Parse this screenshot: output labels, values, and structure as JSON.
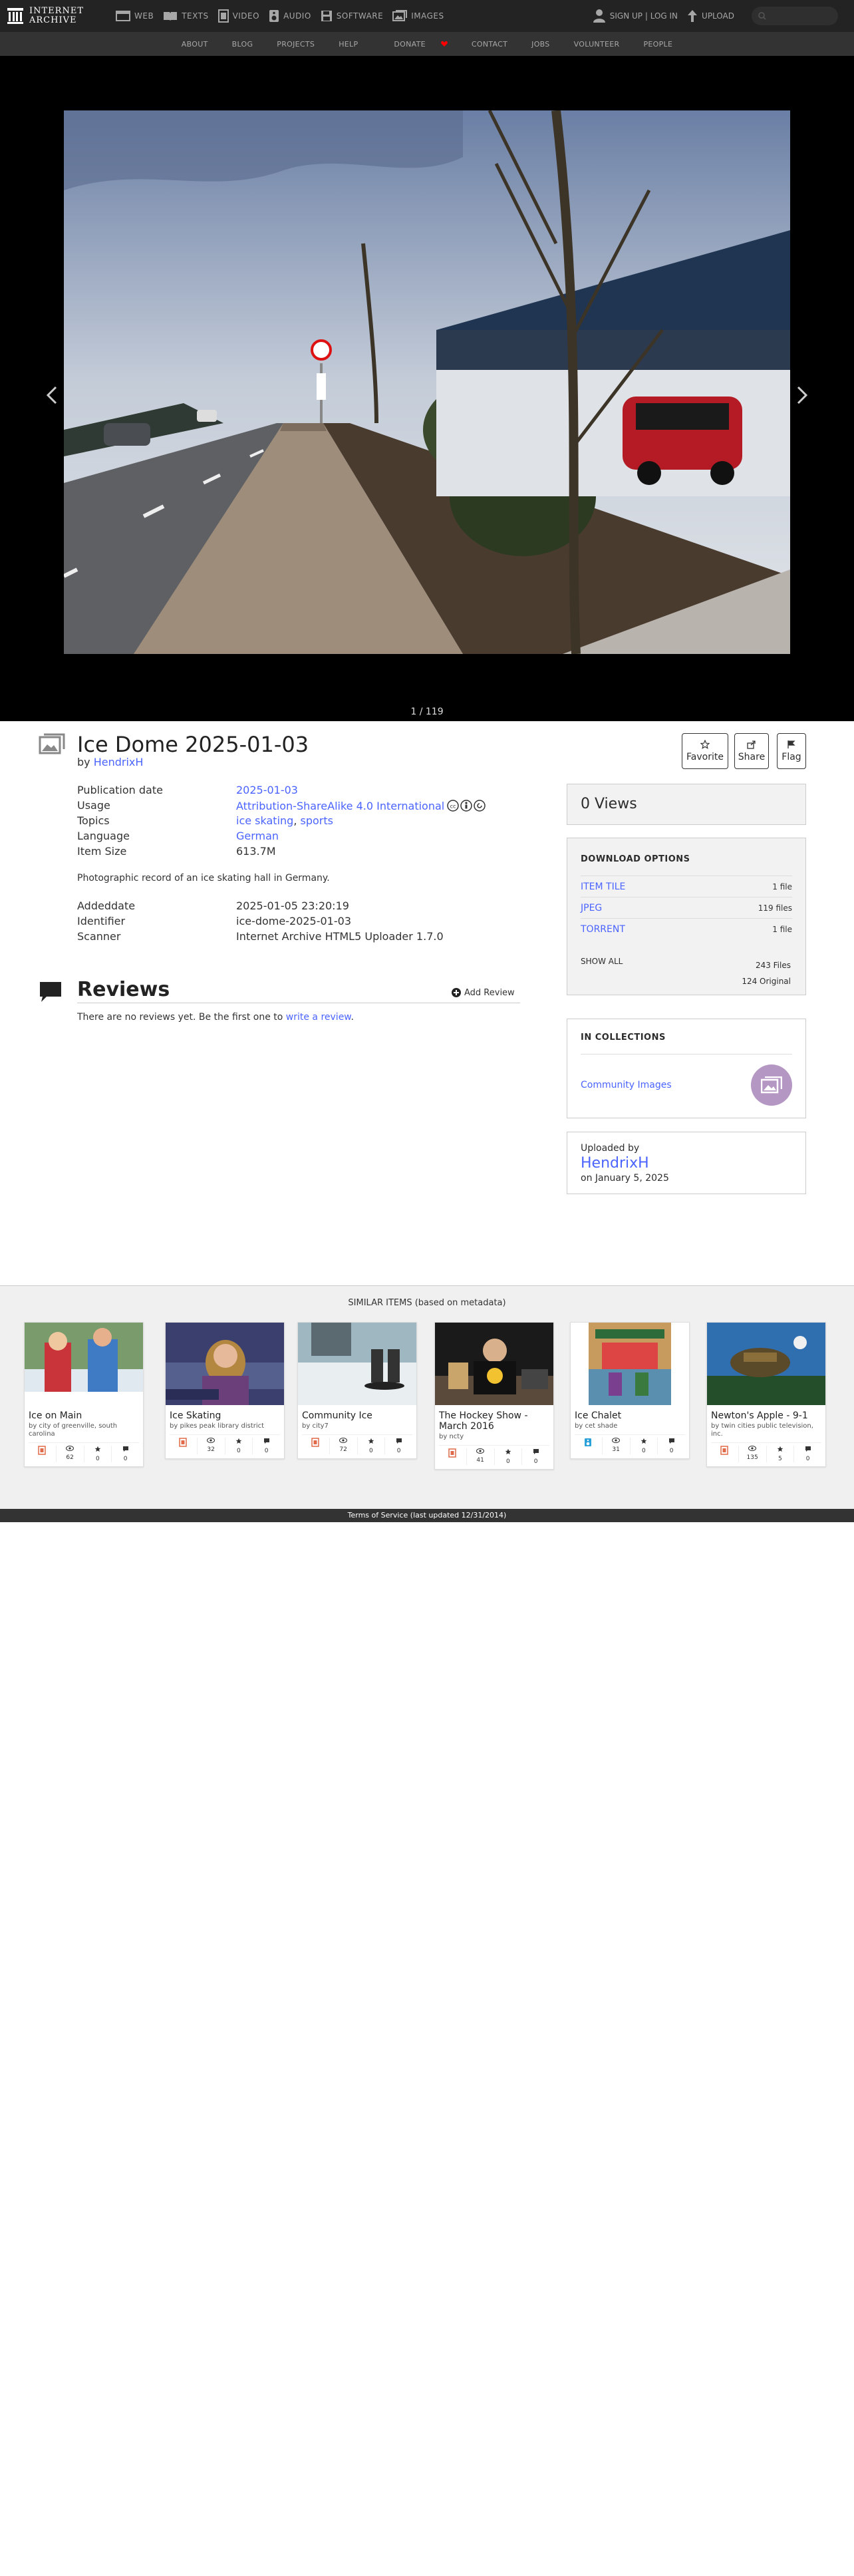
{
  "nav": {
    "logo_line1": "INTERNET",
    "logo_line2": "ARCHIVE",
    "mediatypes": [
      "WEB",
      "TEXTS",
      "VIDEO",
      "AUDIO",
      "SOFTWARE",
      "IMAGES"
    ],
    "signin": "SIGN UP | LOG IN",
    "upload": "UPLOAD"
  },
  "subnav": [
    "ABOUT",
    "BLOG",
    "PROJECTS",
    "HELP",
    "DONATE",
    "CONTACT",
    "JOBS",
    "VOLUNTEER",
    "PEOPLE"
  ],
  "theater": {
    "page_counter": "1 / 119"
  },
  "item": {
    "title": "Ice Dome 2025-01-03",
    "by_prefix": "by ",
    "creator": "HendrixH",
    "actions": [
      "Favorite",
      "Share",
      "Flag"
    ]
  },
  "metadata": {
    "pubdate_label": "Publication date",
    "pubdate": "2025-01-03",
    "usage_label": "Usage",
    "usage": "Attribution-ShareAlike 4.0 International",
    "topics_label": "Topics",
    "topic1": "ice skating",
    "topic_sep": ", ",
    "topic2": "sports",
    "language_label": "Language",
    "language": "German",
    "size_label": "Item Size",
    "size": "613.7M",
    "description": "Photographic record of an ice skating hall in Germany.",
    "addeddate_label": "Addeddate",
    "addeddate": "2025-01-05 23:20:19",
    "identifier_label": "Identifier",
    "identifier": "ice-dome-2025-01-03",
    "scanner_label": "Scanner",
    "scanner": "Internet Archive HTML5 Uploader 1.7.0"
  },
  "reviews": {
    "title": "Reviews",
    "add": "Add Review",
    "empty_text": "There are no reviews yet. Be the first one to ",
    "empty_link": "write a review",
    "empty_end": "."
  },
  "sidebar": {
    "views": "0 Views",
    "download_title": "DOWNLOAD OPTIONS",
    "downloads": [
      {
        "label": "ITEM TILE",
        "count": "1 file"
      },
      {
        "label": "JPEG",
        "count": "119 files"
      },
      {
        "label": "TORRENT",
        "count": "1 file"
      }
    ],
    "show_all": "SHOW ALL",
    "total_files": "243 Files",
    "total_original": "124 Original",
    "collections_title": "IN COLLECTIONS",
    "collection": "Community Images",
    "uploaded_by_label": "Uploaded by",
    "uploader": "HendrixH",
    "upload_date": "on January 5, 2025"
  },
  "similar": {
    "title": "SIMILAR ITEMS (based on metadata)",
    "items": [
      {
        "title": "Ice on Main",
        "by": "by city of greenville, south carolina",
        "views": "62",
        "favs": "0",
        "reviews": "0",
        "type": "movies"
      },
      {
        "title": "Ice Skating",
        "by": "by pikes peak library district",
        "views": "32",
        "favs": "0",
        "reviews": "0",
        "type": "movies"
      },
      {
        "title": "Community Ice",
        "by": "by city7",
        "views": "72",
        "favs": "0",
        "reviews": "0",
        "type": "movies"
      },
      {
        "title": "The Hockey Show - March 2016",
        "by": "by ncty",
        "views": "41",
        "favs": "0",
        "reviews": "0",
        "type": "movies"
      },
      {
        "title": "Ice Chalet",
        "by": "by cet shade",
        "views": "31",
        "favs": "0",
        "reviews": "0",
        "type": "audio"
      },
      {
        "title": "Newton's Apple - 9-1",
        "by": "by twin cities public television, inc.",
        "views": "135",
        "favs": "5",
        "reviews": "0",
        "type": "movies"
      }
    ]
  },
  "footer": "Terms of Service (last updated 12/31/2014)",
  "colors": {
    "link": "#4b64ff",
    "nav_bg": "#232323",
    "subnav_bg": "#333333",
    "collection_circle": "#b597c4",
    "donate_heart": "#ff0000"
  }
}
